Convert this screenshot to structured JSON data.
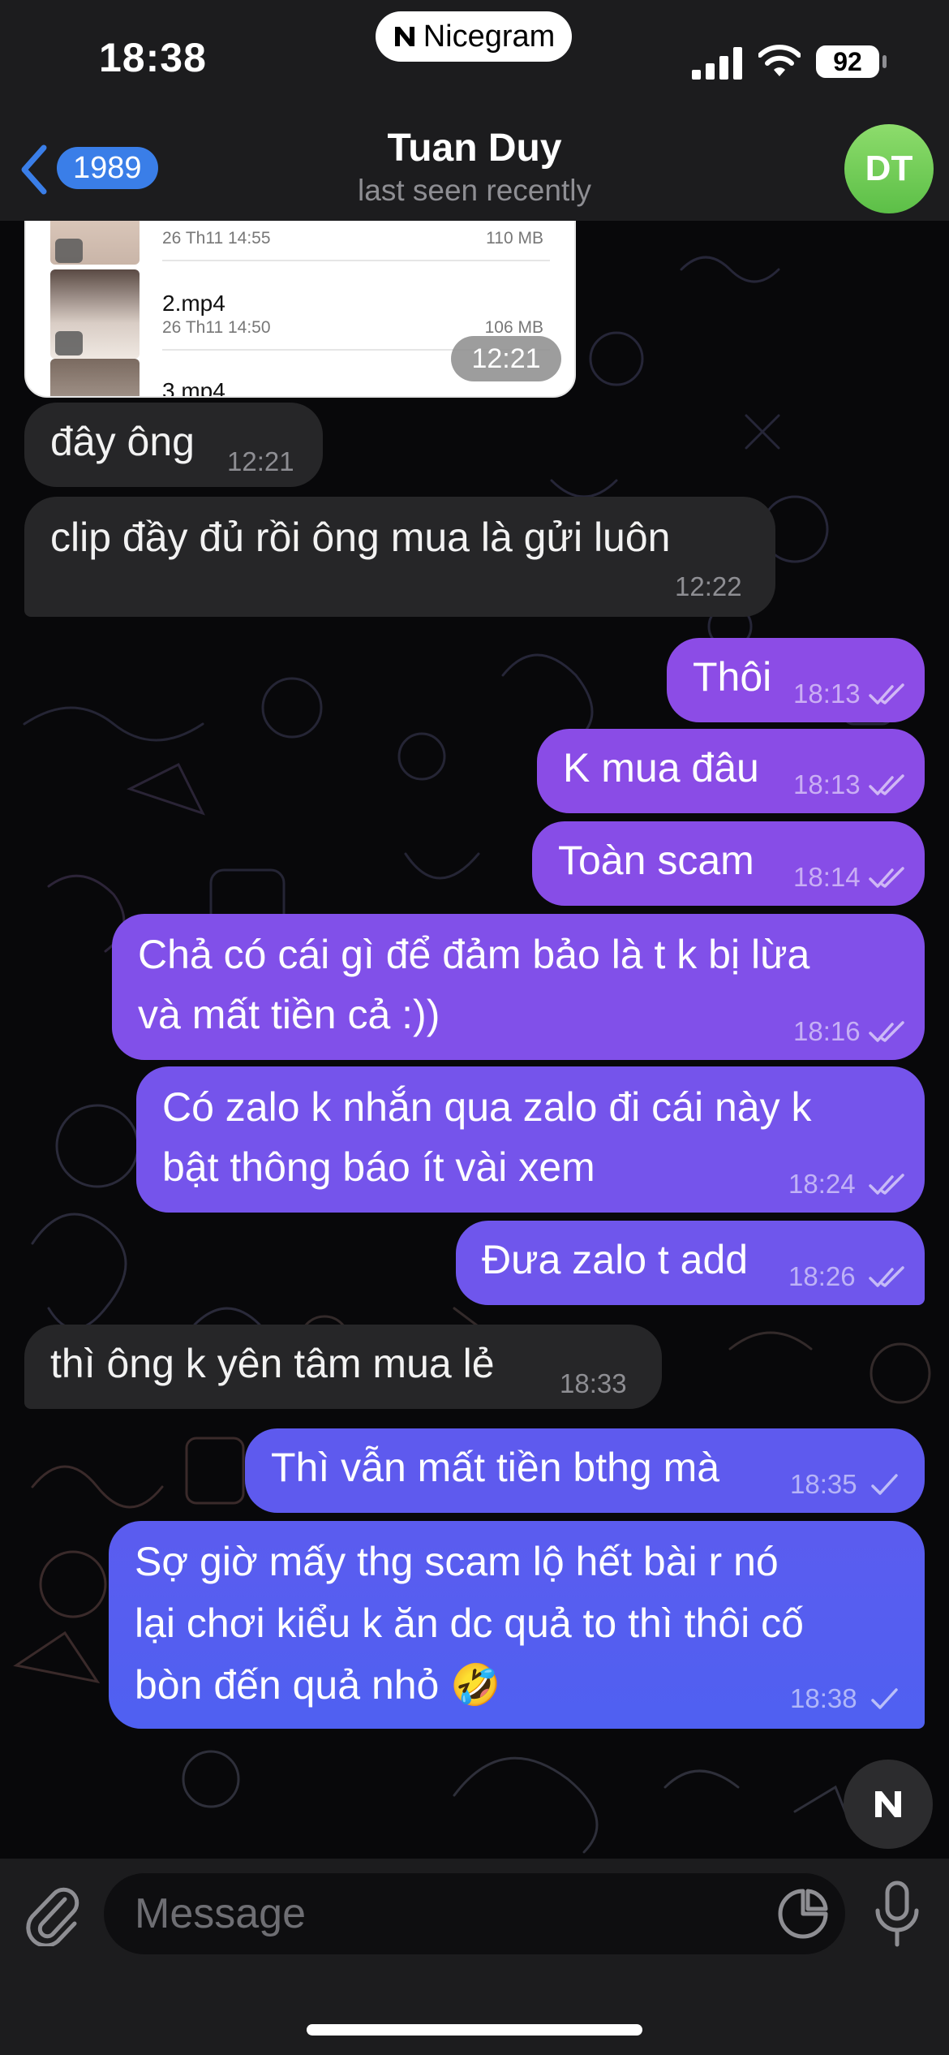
{
  "status_bar": {
    "time": "18:38",
    "carrier_app": "Nicegram",
    "battery": "92"
  },
  "header": {
    "back_badge": "1989",
    "title": "Tuan Duy",
    "subtitle": "last seen recently",
    "avatar_initials": "DT"
  },
  "file_card": {
    "items": [
      {
        "name": "",
        "date": "26 Th11 14:55",
        "size": "110 MB"
      },
      {
        "name": "2.mp4",
        "date": "26 Th11 14:50",
        "size": "106 MB"
      },
      {
        "name": "3.mp4",
        "date": "",
        "size": ""
      }
    ],
    "time": "12:21"
  },
  "messages": [
    {
      "direction": "in",
      "lines": [
        "đây ông"
      ],
      "time": "12:21"
    },
    {
      "direction": "in",
      "lines": [
        "clip đầy đủ rồi ông mua là gửi luôn"
      ],
      "time": "12:22"
    },
    {
      "direction": "out",
      "lines": [
        "Thôi"
      ],
      "time": "18:13",
      "status": "read"
    },
    {
      "direction": "out",
      "lines": [
        "K mua đâu"
      ],
      "time": "18:13",
      "status": "read"
    },
    {
      "direction": "out",
      "lines": [
        "Toàn scam"
      ],
      "time": "18:14",
      "status": "read"
    },
    {
      "direction": "out",
      "lines": [
        "Chả có cái gì để đảm bảo là t k bị lừa",
        "và mất tiền cả :))"
      ],
      "time": "18:16",
      "status": "read"
    },
    {
      "direction": "out",
      "lines": [
        "Có zalo k nhắn qua zalo đi cái này k",
        "bật thông báo ít vài xem"
      ],
      "time": "18:24",
      "status": "read"
    },
    {
      "direction": "out",
      "lines": [
        "Đưa zalo t add"
      ],
      "time": "18:26",
      "status": "read"
    },
    {
      "direction": "in",
      "lines": [
        "thì ông k yên tâm mua lẻ"
      ],
      "time": "18:33"
    },
    {
      "direction": "out",
      "lines": [
        "Thì vẫn mất tiền bthg mà"
      ],
      "time": "18:35",
      "status": "sent"
    },
    {
      "direction": "out",
      "lines": [
        "Sợ giờ mấy thg scam lộ hết bài r nó",
        "lại chơi kiểu k ăn dc quả to thì thôi cố",
        "bòn đến quả nhỏ 🤣"
      ],
      "time": "18:38",
      "status": "sent"
    }
  ],
  "composer": {
    "placeholder": "Message"
  },
  "icons": {
    "back": "chevron-left-icon",
    "attach": "paperclip-icon",
    "sticker": "sticker-icon",
    "mic": "microphone-icon",
    "read": "double-check-icon",
    "sent": "single-check-icon"
  },
  "colors": {
    "accent": "#3a7ee8",
    "incoming_bubble": "#262628",
    "outgoing_gradient_top": "#8a4de8",
    "outgoing_gradient_bottom": "#4f5ff0",
    "avatar": "#6bc84f"
  }
}
